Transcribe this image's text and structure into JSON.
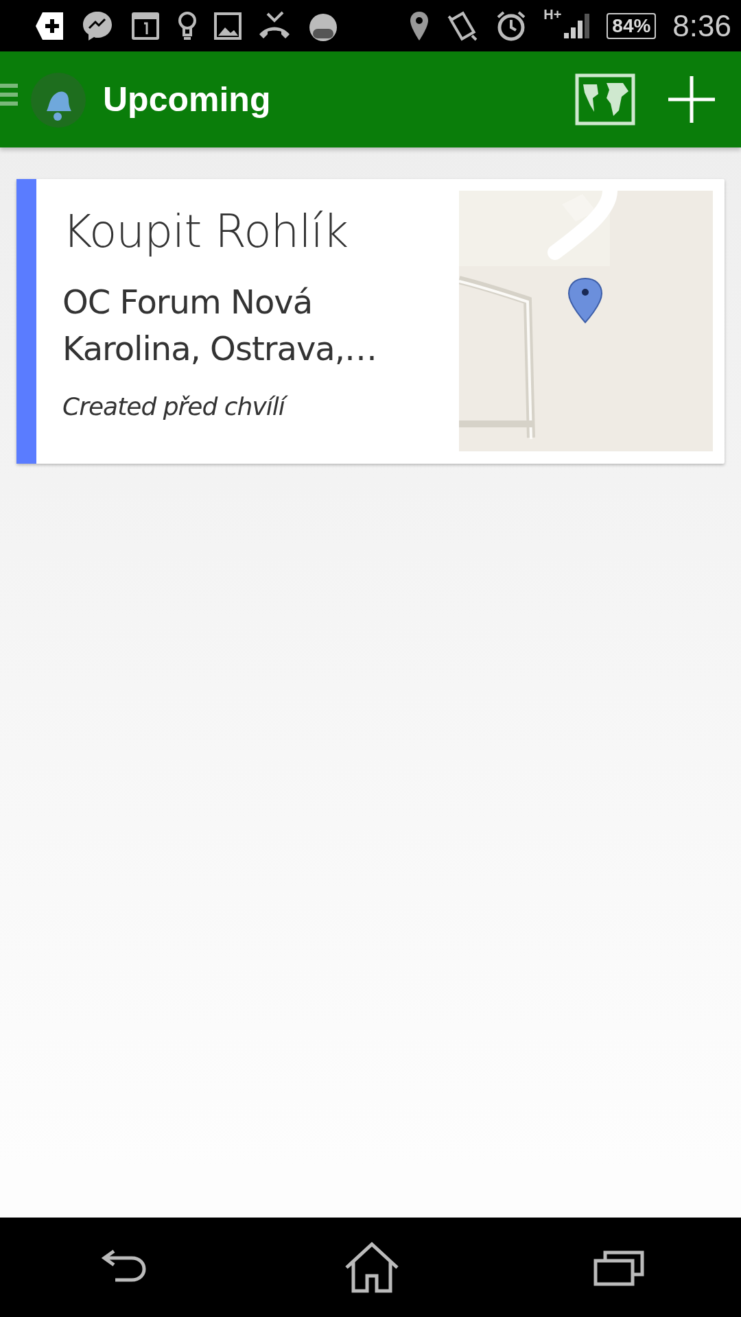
{
  "status_bar": {
    "network": "H+",
    "battery": "84%",
    "time": "8:36"
  },
  "app_bar": {
    "title": "Upcoming"
  },
  "reminders": [
    {
      "title": "Koupit Rohlík",
      "address": "OC Forum Nová Karolina, Ostrava,…",
      "created": "Created před chvílí",
      "color": "#5a7cff"
    }
  ]
}
